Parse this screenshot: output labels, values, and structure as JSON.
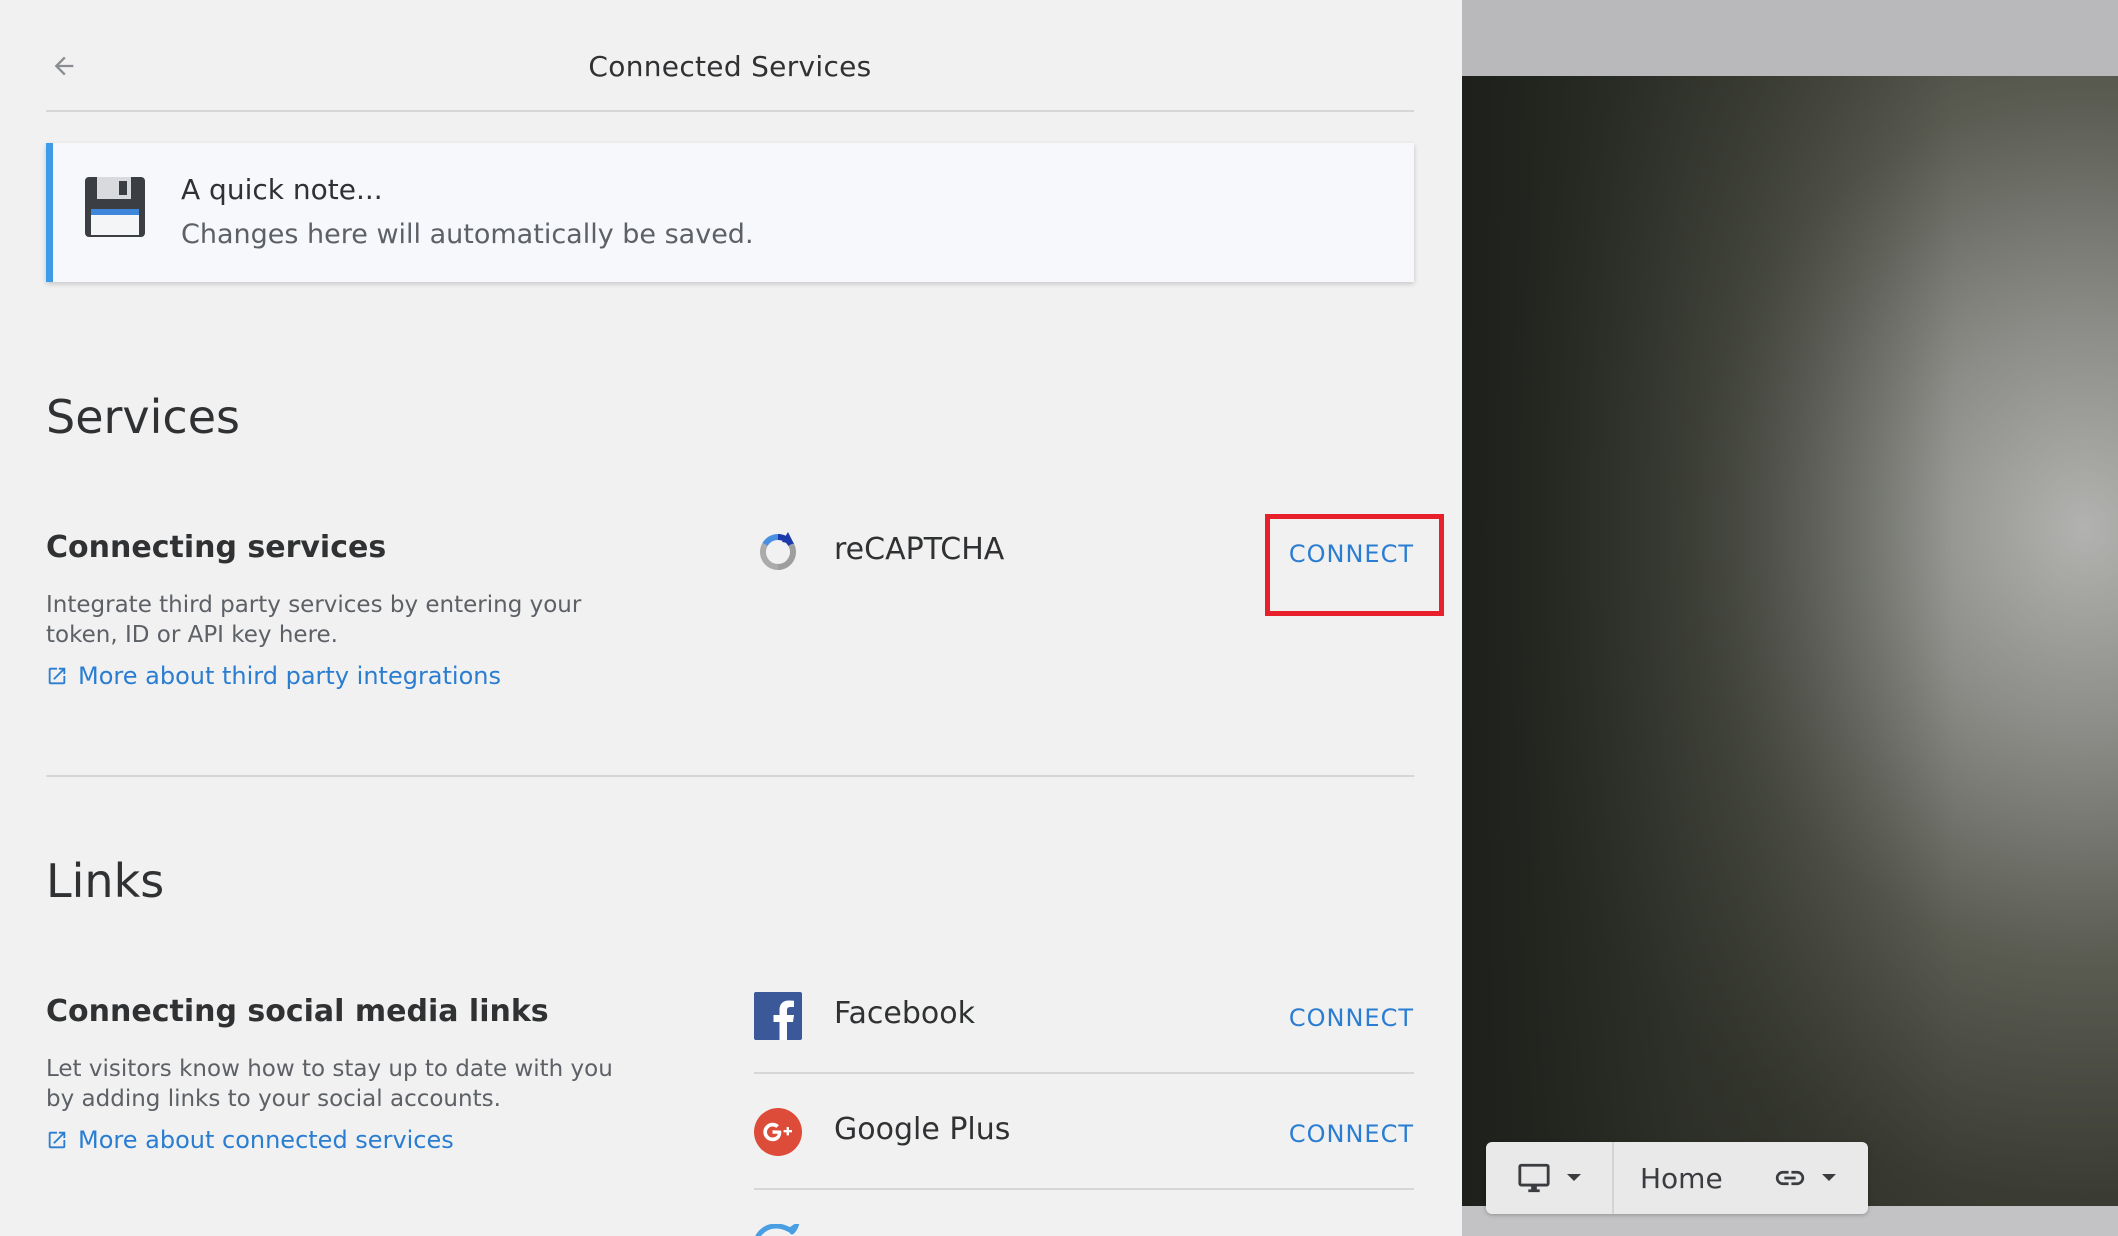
{
  "header": {
    "title": "Connected Services"
  },
  "note": {
    "title": "A quick note...",
    "body": "Changes here will automatically be saved."
  },
  "services": {
    "heading": "Services",
    "subheading": "Connecting services",
    "description": "Integrate third party services by entering your token, ID or API key here.",
    "link": "More about third party integrations",
    "items": [
      {
        "name": "reCAPTCHA",
        "action": "CONNECT",
        "icon": "recaptcha-icon"
      }
    ]
  },
  "links": {
    "heading": "Links",
    "subheading": "Connecting social media links",
    "description": "Let visitors know how to stay up to date with you by adding links to your social accounts.",
    "link": "More about connected services",
    "items": [
      {
        "name": "Facebook",
        "action": "CONNECT",
        "icon": "facebook-icon"
      },
      {
        "name": "Google Plus",
        "action": "CONNECT",
        "icon": "google-plus-icon"
      }
    ]
  },
  "toolbar": {
    "page": "Home",
    "device_icon": "desktop-icon",
    "link_icon": "link-icon"
  },
  "colors": {
    "accent": "#2a7dd1",
    "note_border": "#3d9be9",
    "highlight": "#e8202b",
    "facebook": "#3b5998",
    "google_plus": "#dd4b39"
  }
}
